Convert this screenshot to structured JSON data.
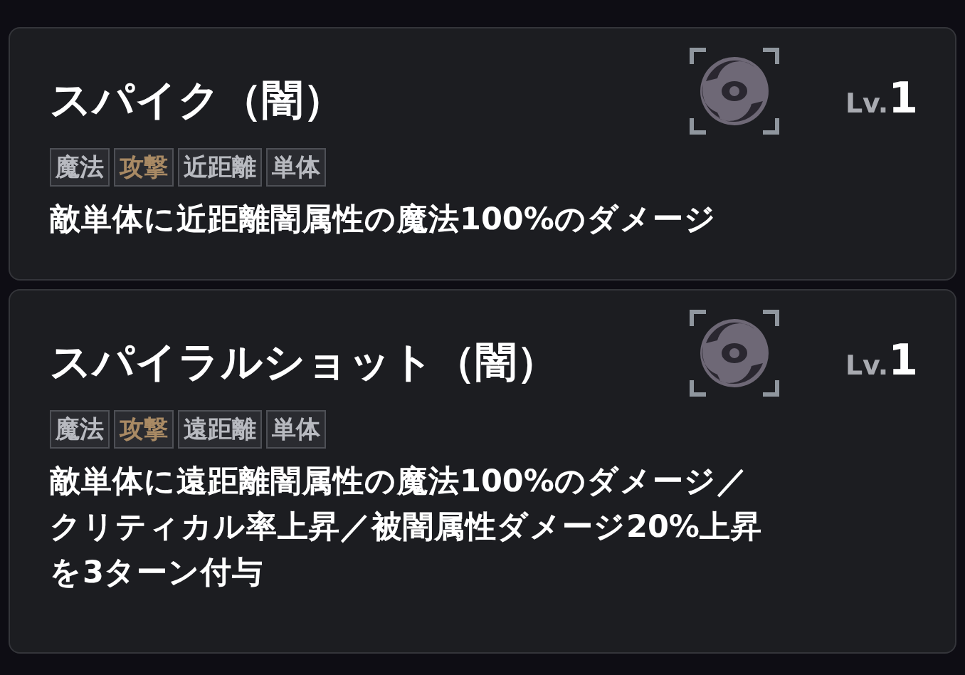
{
  "skills": [
    {
      "name": "スパイク（闇）",
      "level_label": "Lv.",
      "level": "1",
      "tags": [
        {
          "label": "魔法",
          "kind": "normal"
        },
        {
          "label": "攻撃",
          "kind": "attack"
        },
        {
          "label": "近距離",
          "kind": "normal"
        },
        {
          "label": "単体",
          "kind": "normal"
        }
      ],
      "description": [
        "敵単体に近距離闇属性の魔法100%のダメージ"
      ]
    },
    {
      "name": "スパイラルショット（闇）",
      "level_label": "Lv.",
      "level": "1",
      "tags": [
        {
          "label": "魔法",
          "kind": "normal"
        },
        {
          "label": "攻撃",
          "kind": "attack"
        },
        {
          "label": "遠距離",
          "kind": "normal"
        },
        {
          "label": "単体",
          "kind": "normal"
        }
      ],
      "description": [
        "敵単体に遠距離闇属性の魔法100%のダメージ／",
        "クリティカル率上昇／被闇属性ダメージ20%上昇",
        "を3ターン付与"
      ]
    }
  ]
}
